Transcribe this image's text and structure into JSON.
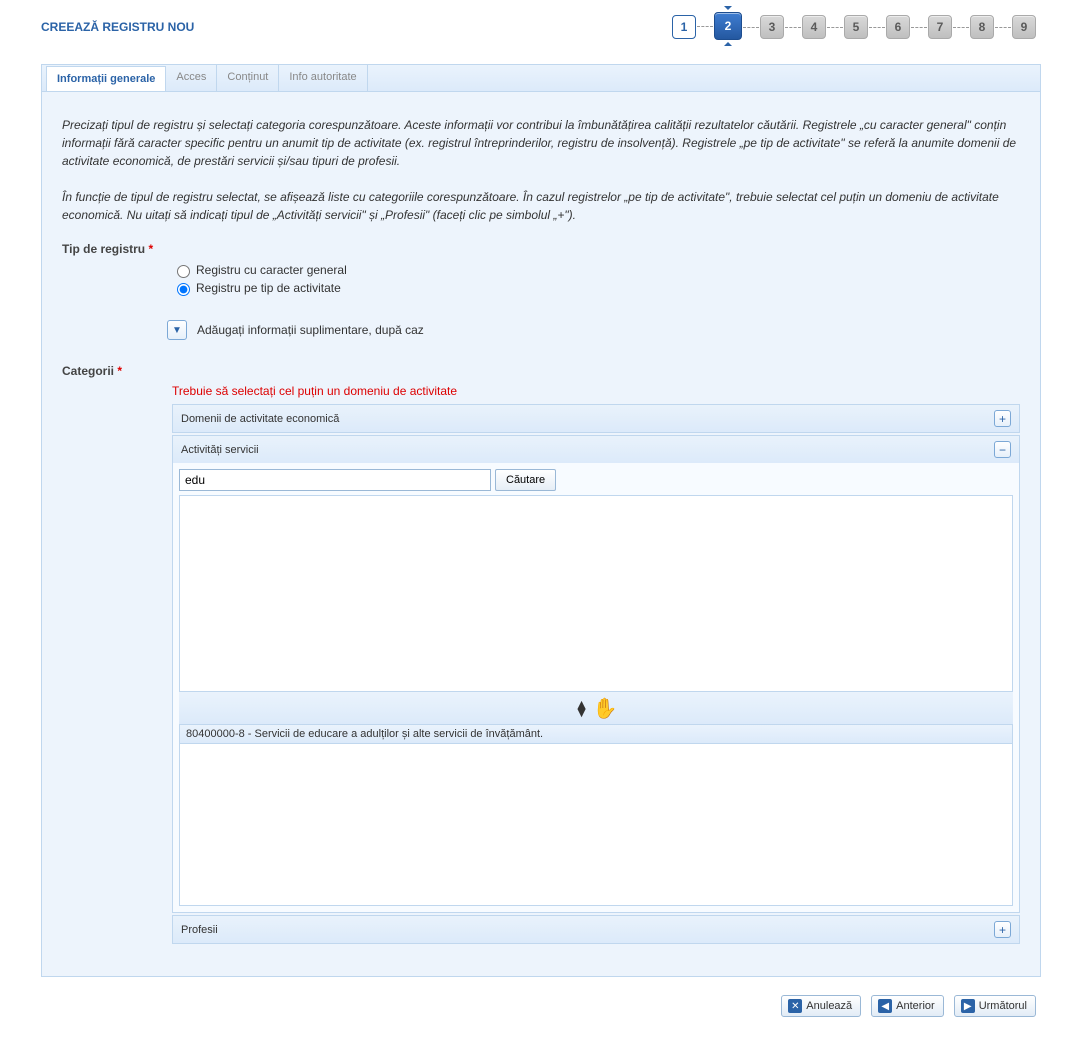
{
  "page_title": "CREEAZĂ REGISTRU NOU",
  "stepper": {
    "current": 2,
    "steps": [
      "1",
      "2",
      "3",
      "4",
      "5",
      "6",
      "7",
      "8",
      "9"
    ]
  },
  "tabs": {
    "items": [
      {
        "label": "Informații generale",
        "active": true
      },
      {
        "label": "Acces",
        "active": false
      },
      {
        "label": "Conținut",
        "active": false
      },
      {
        "label": "Info autoritate",
        "active": false
      }
    ]
  },
  "intro_p1": "Precizați tipul de registru și selectați categoria corespunzătoare. Aceste informații vor contribui la îmbunătățirea calității rezultatelor căutării. Registrele „cu caracter general\" conțin informații fără caracter specific pentru un anumit tip de activitate (ex. registrul întreprinderilor, registru de insolvență). Registrele „pe tip de activitate\" se referă la anumite domenii de activitate economică, de prestări servicii și/sau tipuri de profesii.",
  "intro_p2": "În funcție de tipul de registru selectat, se afișează liste cu categoriile corespunzătoare. În cazul registrelor „pe tip de activitate\", trebuie selectat cel puțin un domeniu de activitate economică. Nu uitați să indicați tipul de „Activități servicii\" și „Profesii\" (faceți clic pe simbolul „+\").",
  "reg_type": {
    "label": "Tip de registru",
    "options": {
      "general": "Registru cu caracter general",
      "activity": "Registru pe tip de activitate"
    },
    "selected": "activity"
  },
  "expander": {
    "label": "Adăugați informații suplimentare, după caz"
  },
  "categories": {
    "label": "Categorii",
    "warning": "Trebuie să selectați cel puțin un domeniu de activitate",
    "section_econ": "Domenii de activitate economică",
    "section_serv": "Activități servicii",
    "section_prof": "Profesii",
    "search_value": "edu",
    "search_btn": "Căutare",
    "selected_item": "80400000-8 - Servicii de educare a adulților și alte servicii de învățământ."
  },
  "nav": {
    "cancel": "Anulează",
    "prev": "Anterior",
    "next": "Următorul"
  }
}
